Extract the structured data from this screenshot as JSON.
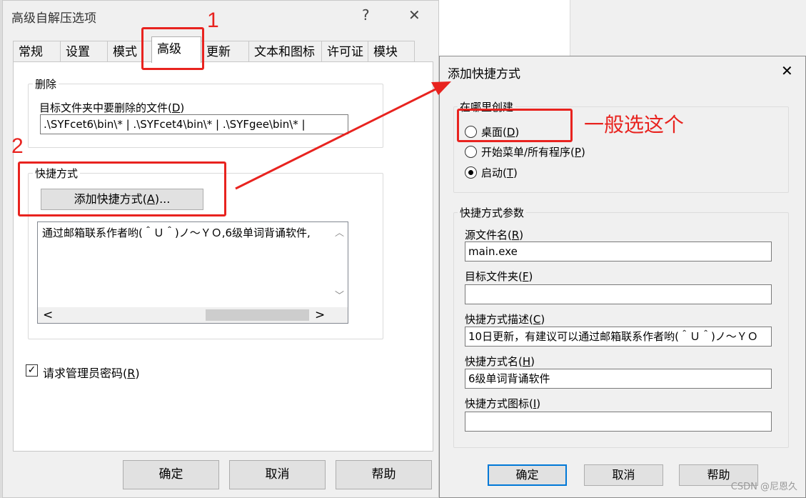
{
  "main_dialog": {
    "title": "高级自解压选项",
    "help_button": "?",
    "close_button": "✕",
    "tabs": [
      {
        "label": "常规"
      },
      {
        "label": "设置"
      },
      {
        "label": "模式"
      },
      {
        "label": "高级"
      },
      {
        "label": "更新"
      },
      {
        "label": "文本和图标"
      },
      {
        "label": "许可证"
      },
      {
        "label": "模块"
      }
    ],
    "delete_group": {
      "title": "删除",
      "field_label": "目标文件夹中要删除的文件(",
      "field_label_key": "D",
      "field_label_end": ")",
      "field_value": ".\\SYFcet6\\bin\\* | .\\SYFcet4\\bin\\* | .\\SYFgee\\bin\\* |"
    },
    "shortcut_group": {
      "title": "快捷方式",
      "add_button_prefix": "添加快捷方式(",
      "add_button_key": "A",
      "add_button_suffix": ")...",
      "memo_text": "通过邮箱联系作者哟(＾Ｕ＾)ノ～ＹＯ,6级单词背诵软件,",
      "scroll_up": "︿",
      "scroll_down": "﹀",
      "scroll_left": "<",
      "scroll_right": ">"
    },
    "admin_checkbox": {
      "checked": true,
      "check_mark": "✓",
      "label": "请求管理员密码(",
      "key": "R",
      "end": ")"
    },
    "buttons": {
      "ok": "确定",
      "cancel": "取消",
      "help": "帮助"
    }
  },
  "shortcut_dialog": {
    "title": "添加快捷方式",
    "close_button": "✕",
    "where_group": {
      "title": "在哪里创建",
      "options": [
        {
          "label": "桌面(",
          "key": "D",
          "end": ")",
          "selected": false
        },
        {
          "label": "开始菜单/所有程序(",
          "key": "P",
          "end": ")",
          "selected": false
        },
        {
          "label": "启动(",
          "key": "T",
          "end": ")",
          "selected": true
        }
      ]
    },
    "params_group": {
      "title": "快捷方式参数",
      "fields": [
        {
          "label": "源文件名(",
          "key": "R",
          "end": ")",
          "value": "main.exe"
        },
        {
          "label": "目标文件夹(",
          "key": "F",
          "end": ")",
          "value": ""
        },
        {
          "label": "快捷方式描述(",
          "key": "C",
          "end": ")",
          "value": "10日更新，有建议可以通过邮箱联系作者哟(＾Ｕ＾)ノ～ＹＯ"
        },
        {
          "label": "快捷方式名(",
          "key": "H",
          "end": ")",
          "value": "6级单词背诵软件"
        },
        {
          "label": "快捷方式图标(",
          "key": "I",
          "end": ")",
          "value": ""
        }
      ]
    },
    "buttons": {
      "ok": "确定",
      "cancel": "取消",
      "help": "帮助"
    }
  },
  "annotations": {
    "num1": "1",
    "num2": "2",
    "note": "一般选这个",
    "color": "#e8231f"
  },
  "watermark": "CSDN @尼恩久"
}
